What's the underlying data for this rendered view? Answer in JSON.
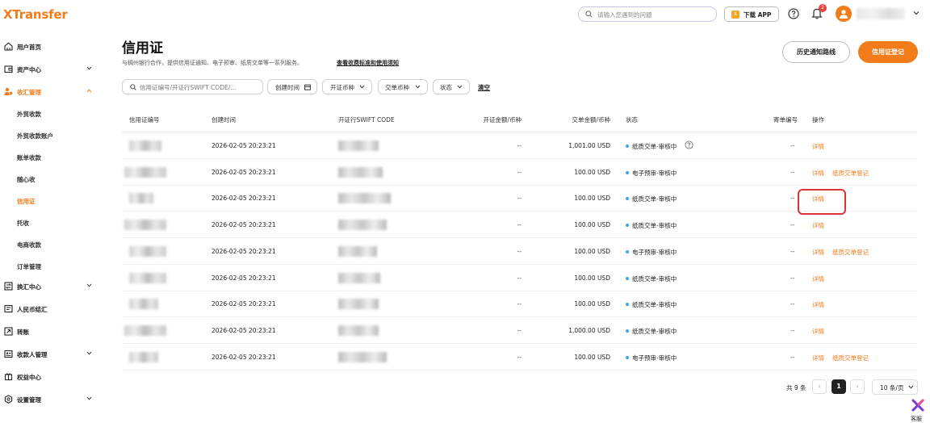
{
  "app": {
    "logo": "XTransfer"
  },
  "header": {
    "search_placeholder": "请输入您遇到的问题",
    "download_label": "下载 APP",
    "notification_count": "2"
  },
  "sidebar": {
    "items": [
      {
        "label": "用户首页",
        "icon": "home-icon"
      },
      {
        "label": "资产中心",
        "icon": "wallet-icon",
        "expandable": true
      },
      {
        "label": "收汇管理",
        "icon": "collection-icon",
        "expanded": true
      },
      {
        "label": "外贸收款"
      },
      {
        "label": "外贸收款账户"
      },
      {
        "label": "账单收款"
      },
      {
        "label": "随心收"
      },
      {
        "label": "信用证",
        "active": true
      },
      {
        "label": "托收"
      },
      {
        "label": "电商收款"
      },
      {
        "label": "订单管理"
      },
      {
        "label": "换汇中心",
        "icon": "exchange-icon",
        "expandable": true
      },
      {
        "label": "人民币结汇",
        "icon": "settlement-icon"
      },
      {
        "label": "转账",
        "icon": "transfer-icon"
      },
      {
        "label": "收款人管理",
        "icon": "payee-icon",
        "expandable": true
      },
      {
        "label": "权益中心",
        "icon": "benefit-icon"
      },
      {
        "label": "设置管理",
        "icon": "settings-icon",
        "expandable": true
      }
    ]
  },
  "main": {
    "title": "信用证",
    "description": "与稠州银行合作，提供信用证通知、电子预审、纸质交单等一系列服务。",
    "description_link": "查看收费标准和使用须知",
    "btn_history": "历史通知路线",
    "btn_register": "信用证登记"
  },
  "filters": {
    "search_placeholder": "信用证编号/开证行SWIFT CODE/...",
    "created_time": "创建时间",
    "currency": "开证币种",
    "delivery_currency": "交单币种",
    "status": "状态",
    "clear": "清空"
  },
  "table": {
    "columns": [
      "信用证编号",
      "创建时间",
      "开证行SWIFT CODE",
      "开证金额/币种",
      "交单金额/币种",
      "状态",
      "寄单编号",
      "操作"
    ],
    "rows": [
      {
        "created": "2026-02-05 20:23:21",
        "issue_amount": "--",
        "delivery_amount": "1,001.00 USD",
        "status": "纸质交单-审核中",
        "status_help": true,
        "mail_no": "--",
        "actions": [
          "详情"
        ]
      },
      {
        "created": "2026-02-05 20:23:21",
        "issue_amount": "--",
        "delivery_amount": "100.00 USD",
        "status": "电子预审-审核中",
        "mail_no": "--",
        "actions": [
          "详情",
          "纸质交单登记"
        ]
      },
      {
        "created": "2026-02-05 20:23:21",
        "issue_amount": "--",
        "delivery_amount": "100.00 USD",
        "status": "纸质交单-审核中",
        "mail_no": "--",
        "actions": [
          "详情"
        ]
      },
      {
        "created": "2026-02-05 20:23:21",
        "issue_amount": "--",
        "delivery_amount": "100.00 USD",
        "status": "纸质交单-审核中",
        "mail_no": "--",
        "actions": [
          "详情"
        ]
      },
      {
        "created": "2026-02-05 20:23:21",
        "issue_amount": "--",
        "delivery_amount": "100.00 USD",
        "status": "电子预审-审核中",
        "mail_no": "--",
        "actions": [
          "详情",
          "纸质交单登记"
        ]
      },
      {
        "created": "2026-02-05 20:23:21",
        "issue_amount": "--",
        "delivery_amount": "100.00 USD",
        "status": "纸质交单-审核中",
        "mail_no": "--",
        "actions": [
          "详情"
        ]
      },
      {
        "created": "2026-02-05 20:23:21",
        "issue_amount": "--",
        "delivery_amount": "100.00 USD",
        "status": "纸质交单-审核中",
        "mail_no": "--",
        "actions": [
          "详情"
        ]
      },
      {
        "created": "2026-02-05 20:23:21",
        "issue_amount": "--",
        "delivery_amount": "1,000.00 USD",
        "status": "纸质交单-审核中",
        "mail_no": "--",
        "actions": [
          "详情"
        ]
      },
      {
        "created": "2026-02-05 20:23:21",
        "issue_amount": "--",
        "delivery_amount": "100.00 USD",
        "status": "电子预审-审核中",
        "mail_no": "--",
        "actions": [
          "详情",
          "纸质交单登记"
        ]
      }
    ]
  },
  "pagination": {
    "total": "共 9 条",
    "current_page": "1",
    "page_size": "10 条/页"
  },
  "support": {
    "label": "客服"
  },
  "colors": {
    "accent": "#f27b1a",
    "status_dot": "#3ba6f2",
    "highlight": "#dd3333"
  }
}
